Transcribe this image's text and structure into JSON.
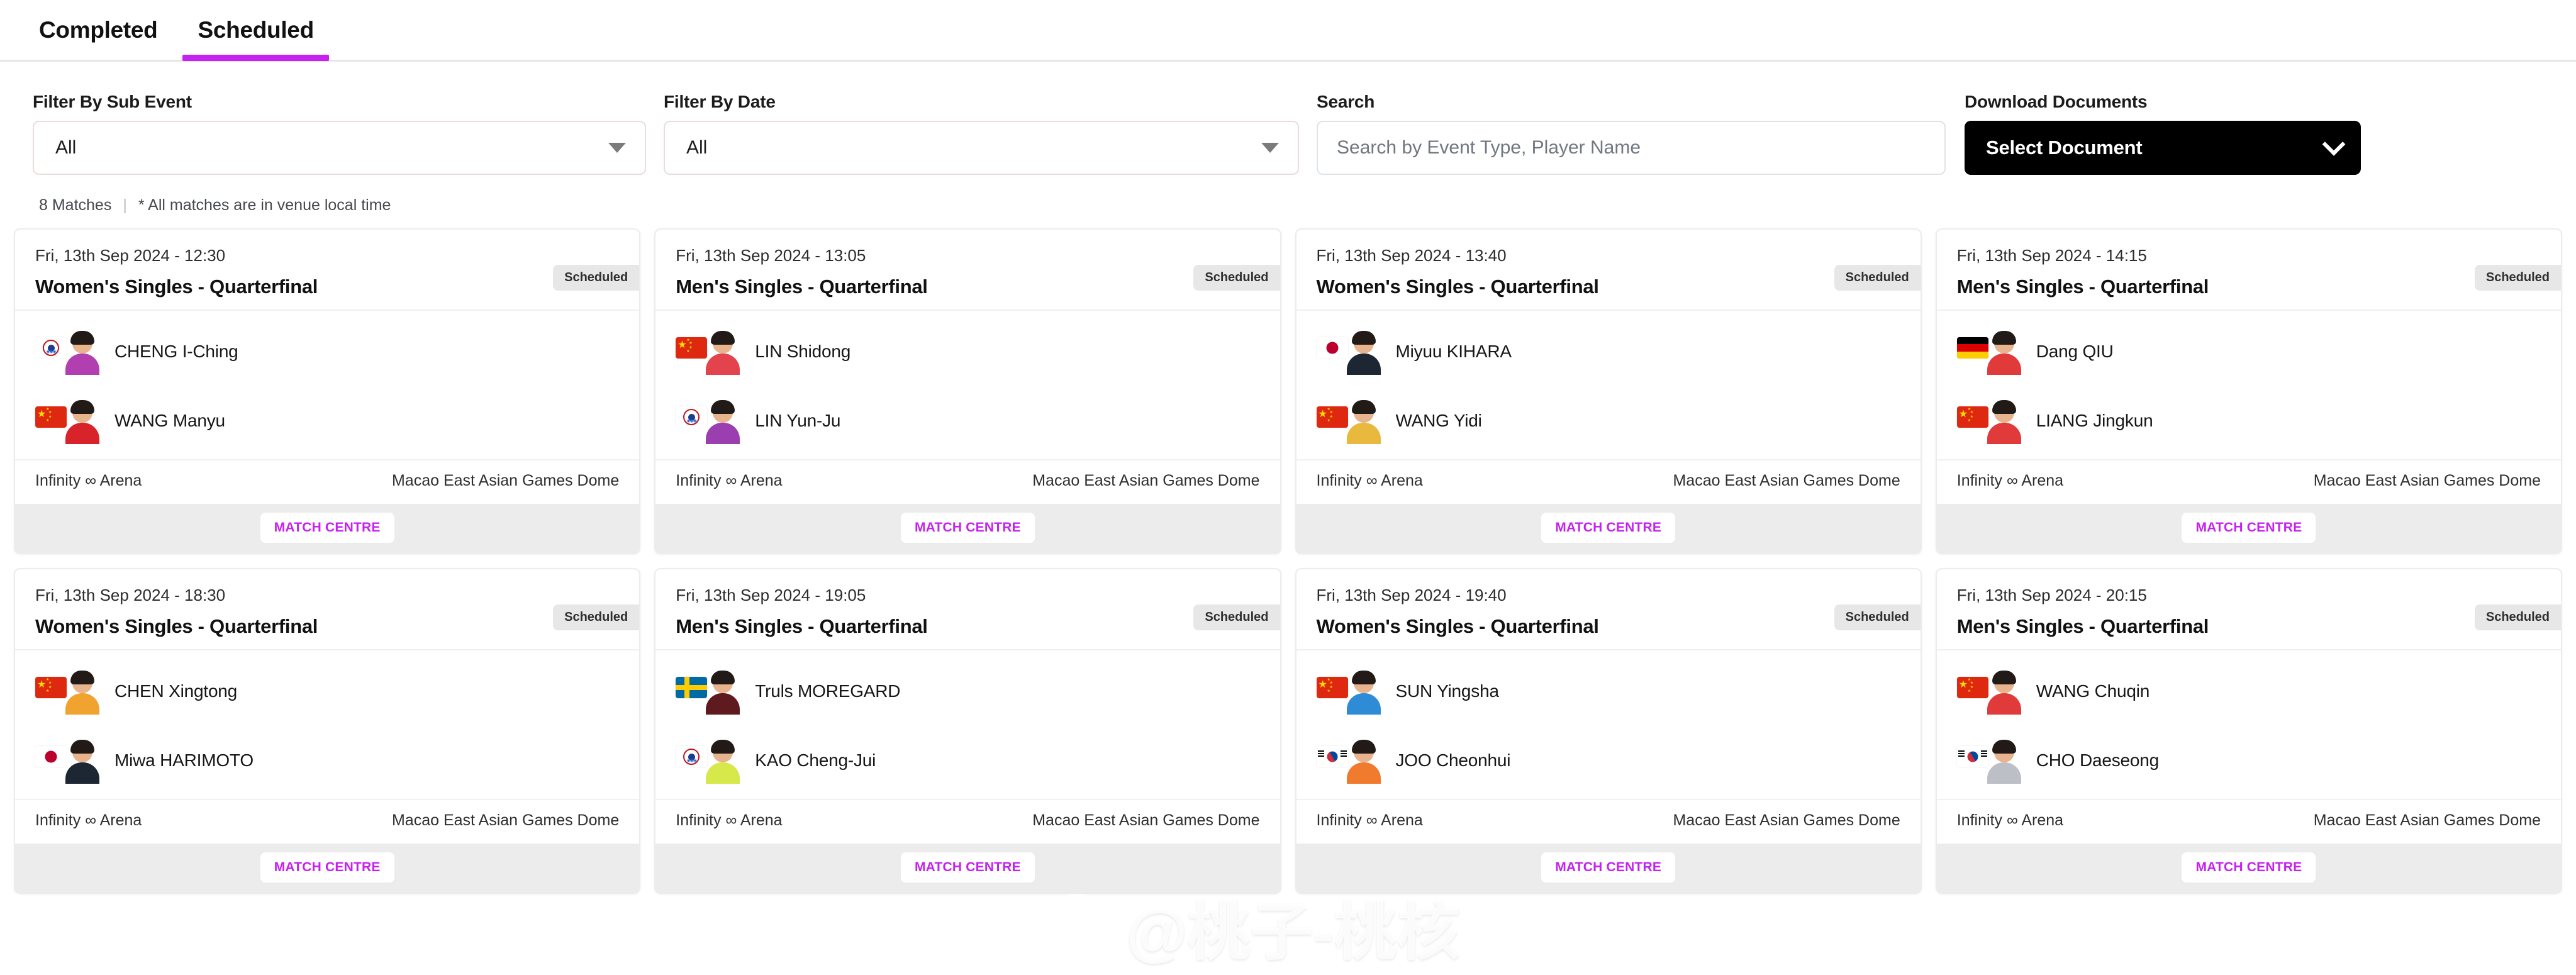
{
  "tabs": [
    {
      "label": "Completed",
      "active": false
    },
    {
      "label": "Scheduled",
      "active": true
    }
  ],
  "filters": {
    "sub_event": {
      "label": "Filter By Sub Event",
      "value": "All",
      "icon": "chevron-down-icon"
    },
    "date": {
      "label": "Filter By Date",
      "value": "All",
      "icon": "chevron-down-icon"
    },
    "search": {
      "label": "Search",
      "value": "",
      "placeholder": "Search by Event Type, Player Name"
    },
    "download": {
      "label": "Download Documents",
      "value": "Select Document",
      "icon": "chevron-down-icon"
    }
  },
  "meta": {
    "match_count": "8 Matches",
    "separator": "|",
    "note": "* All matches are in venue local time"
  },
  "labels": {
    "match_centre": "MATCH CENTRE",
    "status_scheduled": "Scheduled"
  },
  "colors": {
    "accent": "#c621f0",
    "download_button": "#000000",
    "badge_bg": "#e7e7e7",
    "card_footer": "#ececec"
  },
  "watermark": {
    "text": "@桃子-桃核",
    "icon": "weibo-logo-icon"
  },
  "matches": [
    {
      "date": "Fri, 13th Sep 2024 - 12:30",
      "title": "Women's Singles - Quarterfinal",
      "status": "Scheduled",
      "players": [
        {
          "name": "CHENG I-Ching",
          "flag": "tpe",
          "kit": "#b23fb0"
        },
        {
          "name": "WANG Manyu",
          "flag": "cn",
          "kit": "#d8232a"
        }
      ],
      "venue_left": "Infinity ∞ Arena",
      "venue_right": "Macao East Asian Games Dome",
      "action": "MATCH CENTRE"
    },
    {
      "date": "Fri, 13th Sep 2024 - 13:05",
      "title": "Men's Singles - Quarterfinal",
      "status": "Scheduled",
      "players": [
        {
          "name": "LIN Shidong",
          "flag": "cn",
          "kit": "#e3434c"
        },
        {
          "name": "LIN Yun-Ju",
          "flag": "tpe",
          "kit": "#9b3fb0"
        }
      ],
      "venue_left": "Infinity ∞ Arena",
      "venue_right": "Macao East Asian Games Dome",
      "action": "MATCH CENTRE"
    },
    {
      "date": "Fri, 13th Sep 2024 - 13:40",
      "title": "Women's Singles - Quarterfinal",
      "status": "Scheduled",
      "players": [
        {
          "name": "Miyuu KIHARA",
          "flag": "jpn",
          "kit": "#1c2733"
        },
        {
          "name": "WANG Yidi",
          "flag": "cn",
          "kit": "#e8b93c"
        }
      ],
      "venue_left": "Infinity ∞ Arena",
      "venue_right": "Macao East Asian Games Dome",
      "action": "MATCH CENTRE"
    },
    {
      "date": "Fri, 13th Sep 2024 - 14:15",
      "title": "Men's Singles - Quarterfinal",
      "status": "Scheduled",
      "players": [
        {
          "name": "Dang QIU",
          "flag": "ger",
          "kit": "#e03a3a"
        },
        {
          "name": "LIANG Jingkun",
          "flag": "cn",
          "kit": "#e03a3a"
        }
      ],
      "venue_left": "Infinity ∞ Arena",
      "venue_right": "Macao East Asian Games Dome",
      "action": "MATCH CENTRE"
    },
    {
      "date": "Fri, 13th Sep 2024 - 18:30",
      "title": "Women's Singles - Quarterfinal",
      "status": "Scheduled",
      "players": [
        {
          "name": "CHEN Xingtong",
          "flag": "cn",
          "kit": "#f0a32e"
        },
        {
          "name": "Miwa HARIMOTO",
          "flag": "jpn",
          "kit": "#1c2733"
        }
      ],
      "venue_left": "Infinity ∞ Arena",
      "venue_right": "Macao East Asian Games Dome",
      "action": "MATCH CENTRE"
    },
    {
      "date": "Fri, 13th Sep 2024 - 19:05",
      "title": "Men's Singles - Quarterfinal",
      "status": "Scheduled",
      "players": [
        {
          "name": "Truls MOREGARD",
          "flag": "swe",
          "kit": "#5e1a1f"
        },
        {
          "name": "KAO Cheng-Jui",
          "flag": "tpe",
          "kit": "#d6e84a"
        }
      ],
      "venue_left": "Infinity ∞ Arena",
      "venue_right": "Macao East Asian Games Dome",
      "action": "MATCH CENTRE"
    },
    {
      "date": "Fri, 13th Sep 2024 - 19:40",
      "title": "Women's Singles - Quarterfinal",
      "status": "Scheduled",
      "players": [
        {
          "name": "SUN Yingsha",
          "flag": "cn",
          "kit": "#2e8bd6"
        },
        {
          "name": "JOO Cheonhui",
          "flag": "kor",
          "kit": "#f07a2e"
        }
      ],
      "venue_left": "Infinity ∞ Arena",
      "venue_right": "Macao East Asian Games Dome",
      "action": "MATCH CENTRE"
    },
    {
      "date": "Fri, 13th Sep 2024 - 20:15",
      "title": "Men's Singles - Quarterfinal",
      "status": "Scheduled",
      "players": [
        {
          "name": "WANG Chuqin",
          "flag": "cn",
          "kit": "#e03a3a"
        },
        {
          "name": "CHO Daeseong",
          "flag": "kor",
          "kit": "#bdbfc7"
        }
      ],
      "venue_left": "Infinity ∞ Arena",
      "venue_right": "Macao East Asian Games Dome",
      "action": "MATCH CENTRE"
    }
  ]
}
